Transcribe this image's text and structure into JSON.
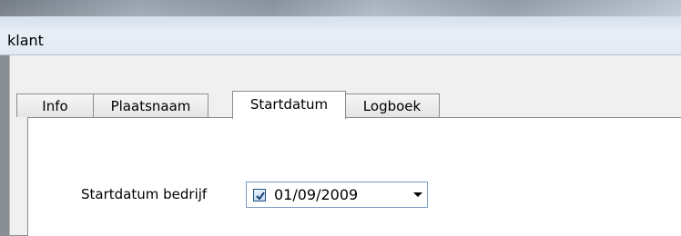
{
  "window": {
    "title": "klant"
  },
  "tabs": [
    {
      "label": "Info"
    },
    {
      "label": "Plaatsnaam"
    },
    {
      "label": "Startdatum"
    },
    {
      "label": "Logboek"
    }
  ],
  "form": {
    "label": "Startdatum bedrijf",
    "date_value": "01/09/2009",
    "checked": true
  }
}
